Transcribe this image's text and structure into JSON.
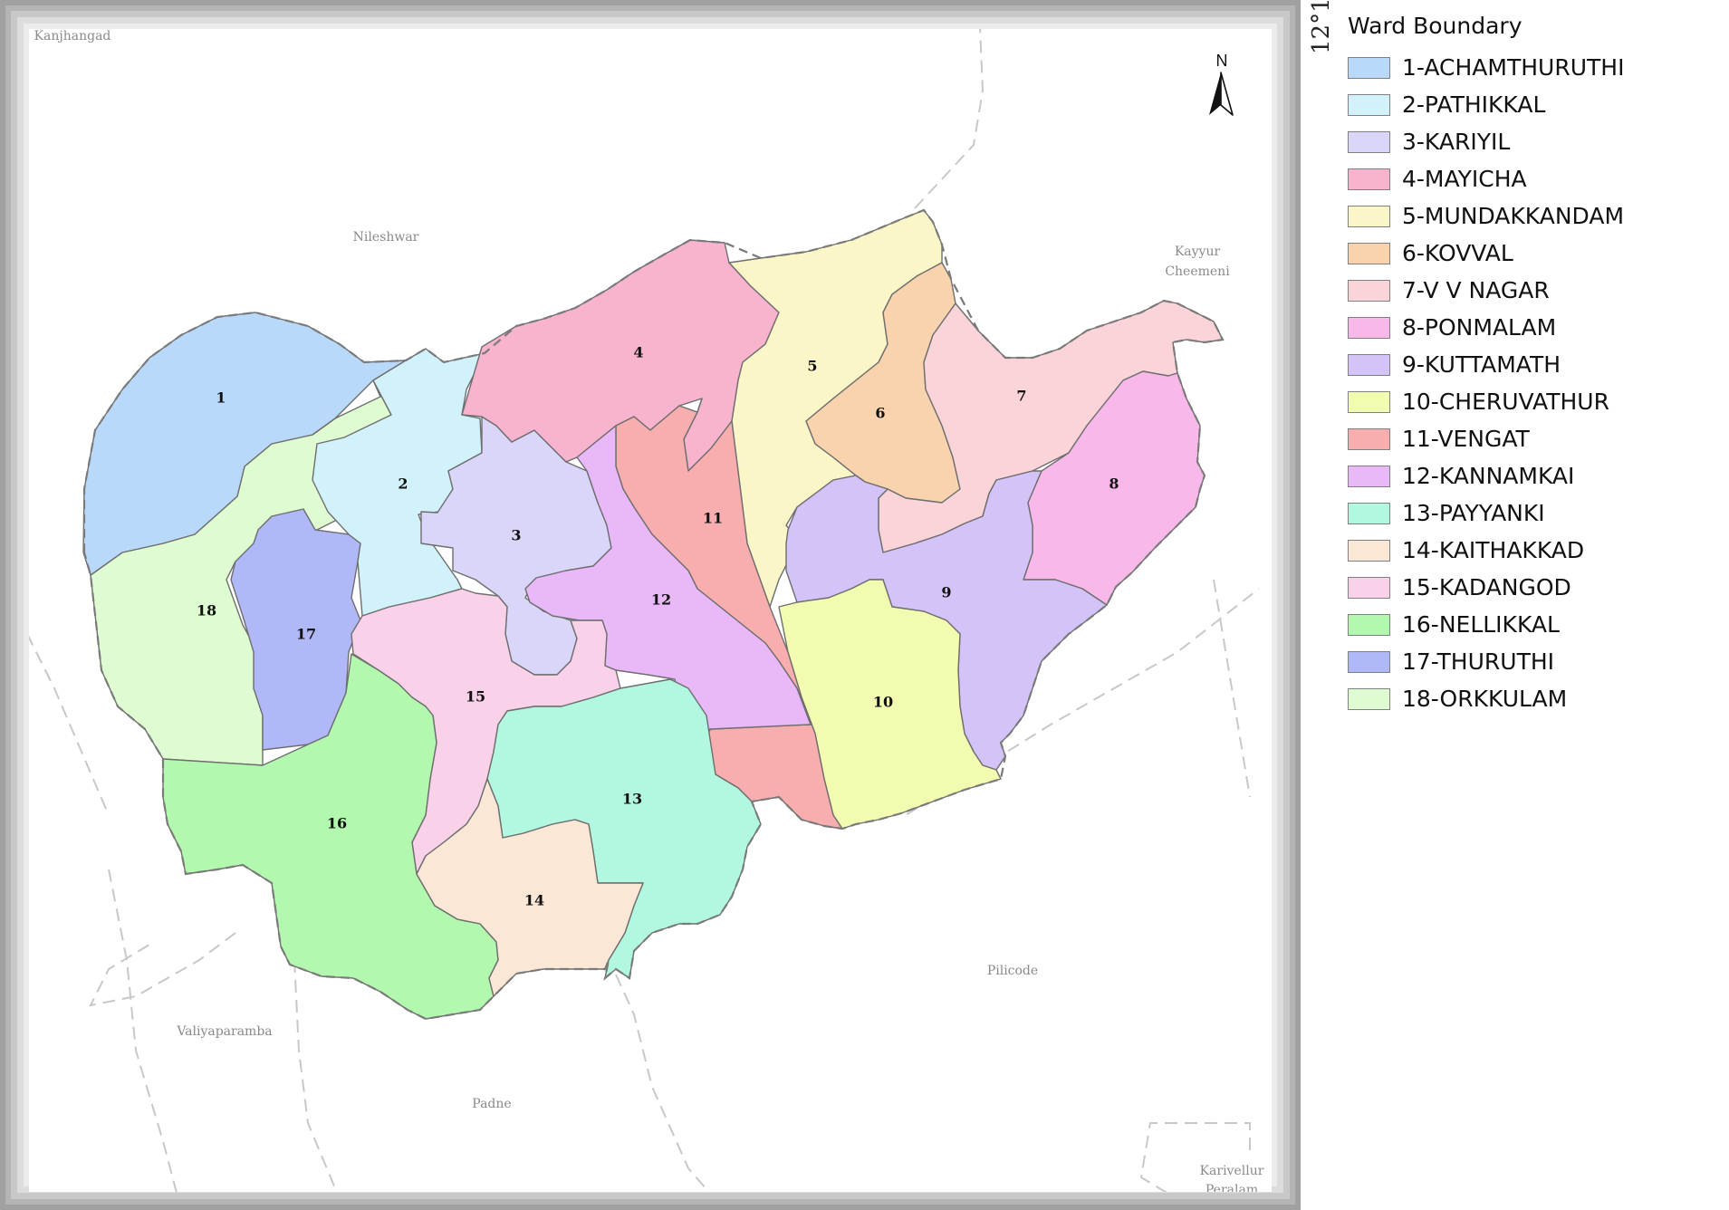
{
  "map": {
    "north_label": "N",
    "grat_label": "12°1",
    "places": [
      {
        "key": "kanjhangad",
        "lines": [
          "Kanjhangad"
        ]
      },
      {
        "key": "nileshwar",
        "lines": [
          "Nileshwar"
        ]
      },
      {
        "key": "kayyur",
        "lines": [
          "Kayyur",
          "Cheemeni"
        ]
      },
      {
        "key": "pilicode",
        "lines": [
          "Pilicode"
        ]
      },
      {
        "key": "valiyaparamba",
        "lines": [
          "Valiyaparamba"
        ]
      },
      {
        "key": "padne",
        "lines": [
          "Padne"
        ]
      },
      {
        "key": "karivellur",
        "lines": [
          "Karivellur",
          "Peralam"
        ]
      }
    ]
  },
  "legend": {
    "title": "Ward Boundary",
    "items": [
      {
        "num": "1",
        "label": "1-ACHAMTHURUTHI",
        "color": "#b9d9fb"
      },
      {
        "num": "2",
        "label": "2-PATHIKKAL",
        "color": "#d2f2fb"
      },
      {
        "num": "3",
        "label": "3-KARIYIL",
        "color": "#dad6fa"
      },
      {
        "num": "4",
        "label": "4-MAYICHA",
        "color": "#f8b3cf"
      },
      {
        "num": "5",
        "label": "5-MUNDAKKANDAM",
        "color": "#fbf6c8"
      },
      {
        "num": "6",
        "label": "6-KOVVAL",
        "color": "#f8d3ae"
      },
      {
        "num": "7",
        "label": "7-V V NAGAR",
        "color": "#fad4d8"
      },
      {
        "num": "8",
        "label": "8-PONMALAM",
        "color": "#f9b8ea"
      },
      {
        "num": "9",
        "label": "9-KUTTAMATH",
        "color": "#d4c3f9"
      },
      {
        "num": "10",
        "label": "10-CHERUVATHUR",
        "color": "#f2fbaf"
      },
      {
        "num": "11",
        "label": "11-VENGAT",
        "color": "#f8aeae"
      },
      {
        "num": "12",
        "label": "12-KANNAMKAI",
        "color": "#e9b8f9"
      },
      {
        "num": "13",
        "label": "13-PAYYANKI",
        "color": "#b2f8e0"
      },
      {
        "num": "14",
        "label": "14-KAITHAKKAD",
        "color": "#fae7d5"
      },
      {
        "num": "15",
        "label": "15-KADANGOD",
        "color": "#f9d2ea"
      },
      {
        "num": "16",
        "label": "16-NELLIKKAL",
        "color": "#b2f8ae"
      },
      {
        "num": "17",
        "label": "17-THURUTHI",
        "color": "#b0b8f8"
      },
      {
        "num": "18",
        "label": "18-ORKKULAM",
        "color": "#dffbd2"
      }
    ]
  }
}
